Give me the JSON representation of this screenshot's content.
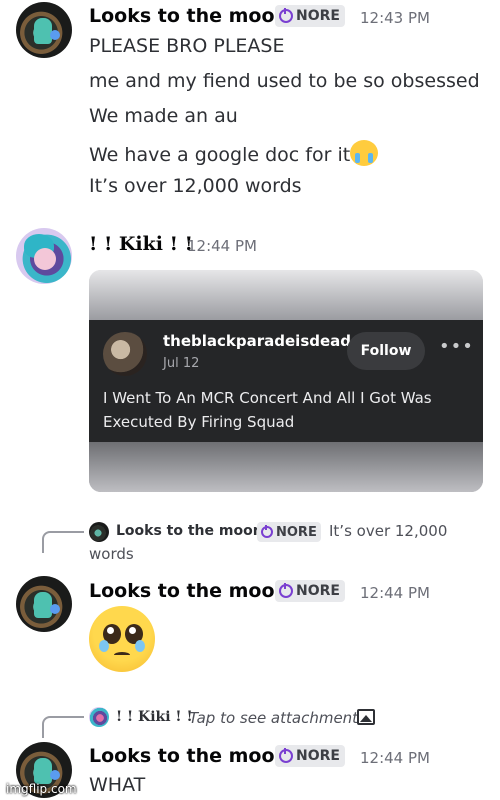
{
  "messages": [
    {
      "author": "Looks to the moon",
      "tag": "NORE",
      "time": "12:43 PM",
      "lines": [
        "PLEASE BRO PLEASE",
        "me and my fiend used to be so obsessed",
        "We made an au",
        "We have a google doc for it",
        "It’s over 12,000 words"
      ]
    },
    {
      "author": "! ! Kiki ! !",
      "time": "12:44 PM",
      "embed": {
        "username": "theblackparadeisdead",
        "date": "Jul 12",
        "follow_label": "Follow",
        "more_label": "•••",
        "text": "I Went To An MCR Concert And All I Got Was Executed By Firing Squad"
      }
    },
    {
      "reply": {
        "author": "Looks to the moon",
        "tag": "NORE",
        "text_line1": "It’s over 12,000",
        "text_line2": "words"
      },
      "author": "Looks to the moon",
      "tag": "NORE",
      "time": "12:44 PM",
      "emoji": "pleading-face"
    },
    {
      "reply": {
        "author": "! ! Kiki ! !",
        "text": "Tap to see attachment"
      },
      "author": "Looks to the moon",
      "tag": "NORE",
      "time": "12:44 PM",
      "lines": [
        "WHAT"
      ]
    }
  ],
  "icons": {
    "tag": "power-icon",
    "attachment": "image-icon"
  },
  "accent_colors": {
    "tag_icon": "#7a3fd1",
    "timestamp": "#6d6f78"
  },
  "watermark": "imgflip.com"
}
